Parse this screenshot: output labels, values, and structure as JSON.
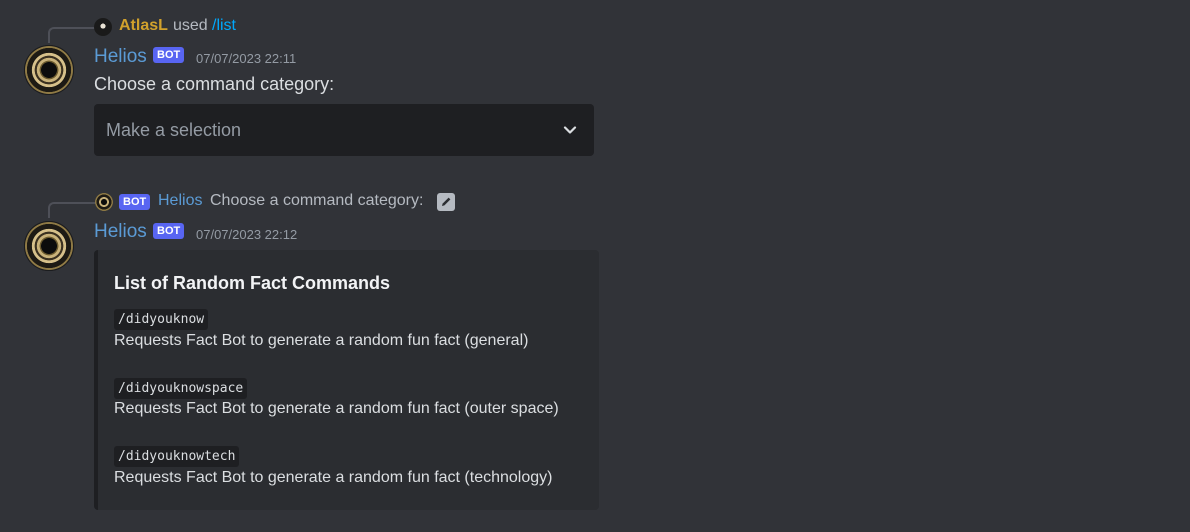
{
  "messages": [
    {
      "reply": {
        "user": "AtlasL",
        "action": "used",
        "command": "/list"
      },
      "author": "Helios",
      "bot_tag": "BOT",
      "timestamp": "07/07/2023 22:11",
      "content": "Choose a command category:",
      "select": {
        "placeholder": "Make a selection",
        "icon": "chevron-down-icon"
      }
    },
    {
      "reply": {
        "bot_tag": "BOT",
        "user": "Helios",
        "content": "Choose a command category:",
        "icon": "edit-icon"
      },
      "author": "Helios",
      "bot_tag": "BOT",
      "timestamp": "07/07/2023 22:12",
      "embed": {
        "title": "List of Random Fact Commands",
        "commands": [
          {
            "name": "/didyouknow",
            "desc": "Requests Fact Bot to generate a random fun fact (general)"
          },
          {
            "name": "/didyouknowspace",
            "desc": "Requests Fact Bot to generate a random fun fact (outer space)"
          },
          {
            "name": "/didyouknowtech",
            "desc": "Requests Fact Bot to generate a random fun fact (technology)"
          }
        ]
      }
    }
  ],
  "colors": {
    "background": "#313338",
    "embed_bg": "#2b2d31",
    "bot_tag": "#5865f2",
    "username_yellow": "#d1a12c",
    "username_blue": "#5b9bd5",
    "link": "#00a8fc"
  }
}
